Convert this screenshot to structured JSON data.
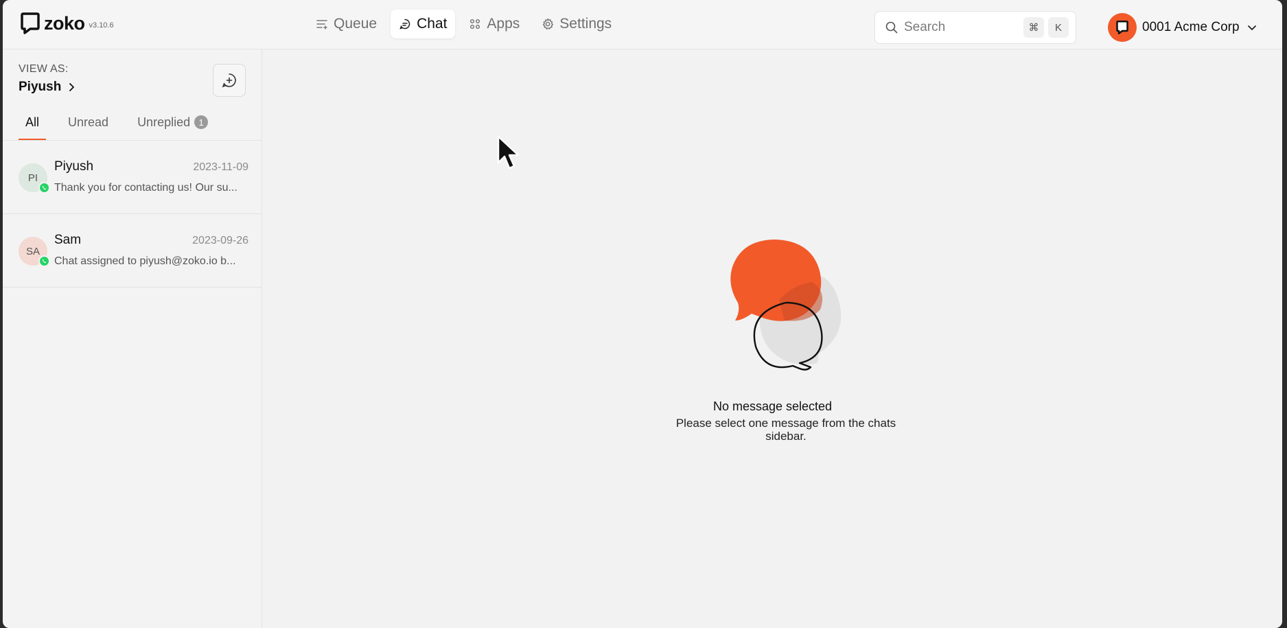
{
  "app": {
    "logo_text": "zoko",
    "version": "v3.10.6"
  },
  "nav": {
    "items": [
      {
        "label": "Queue",
        "icon": "queue-icon",
        "active": false
      },
      {
        "label": "Chat",
        "icon": "chat-bubble-icon",
        "active": true
      },
      {
        "label": "Apps",
        "icon": "apps-grid-icon",
        "active": false
      },
      {
        "label": "Settings",
        "icon": "gear-icon",
        "active": false
      }
    ]
  },
  "search": {
    "placeholder": "Search",
    "shortcut_keys": [
      "⌘",
      "K"
    ]
  },
  "account": {
    "name": "0001 Acme Corp",
    "avatar_color": "#f25a2a"
  },
  "sidebar": {
    "view_as_label": "VIEW AS:",
    "view_as_user": "Piyush",
    "tabs": [
      {
        "label": "All",
        "active": true
      },
      {
        "label": "Unread",
        "active": false
      },
      {
        "label": "Unreplied",
        "active": false,
        "badge": "1"
      }
    ],
    "chats": [
      {
        "initials": "PI",
        "avatar_bg": "#dce8e0",
        "name": "Piyush",
        "date": "2023-11-09",
        "preview": "Thank you for contacting us! Our su..."
      },
      {
        "initials": "SA",
        "avatar_bg": "#f3d9d2",
        "name": "Sam",
        "date": "2023-09-26",
        "preview": "Chat assigned to piyush@zoko.io b..."
      }
    ]
  },
  "main": {
    "empty_title": "No message selected",
    "empty_subtitle": "Please select one message from the chats sidebar."
  },
  "colors": {
    "accent": "#f25a2a",
    "whatsapp": "#25d366"
  }
}
